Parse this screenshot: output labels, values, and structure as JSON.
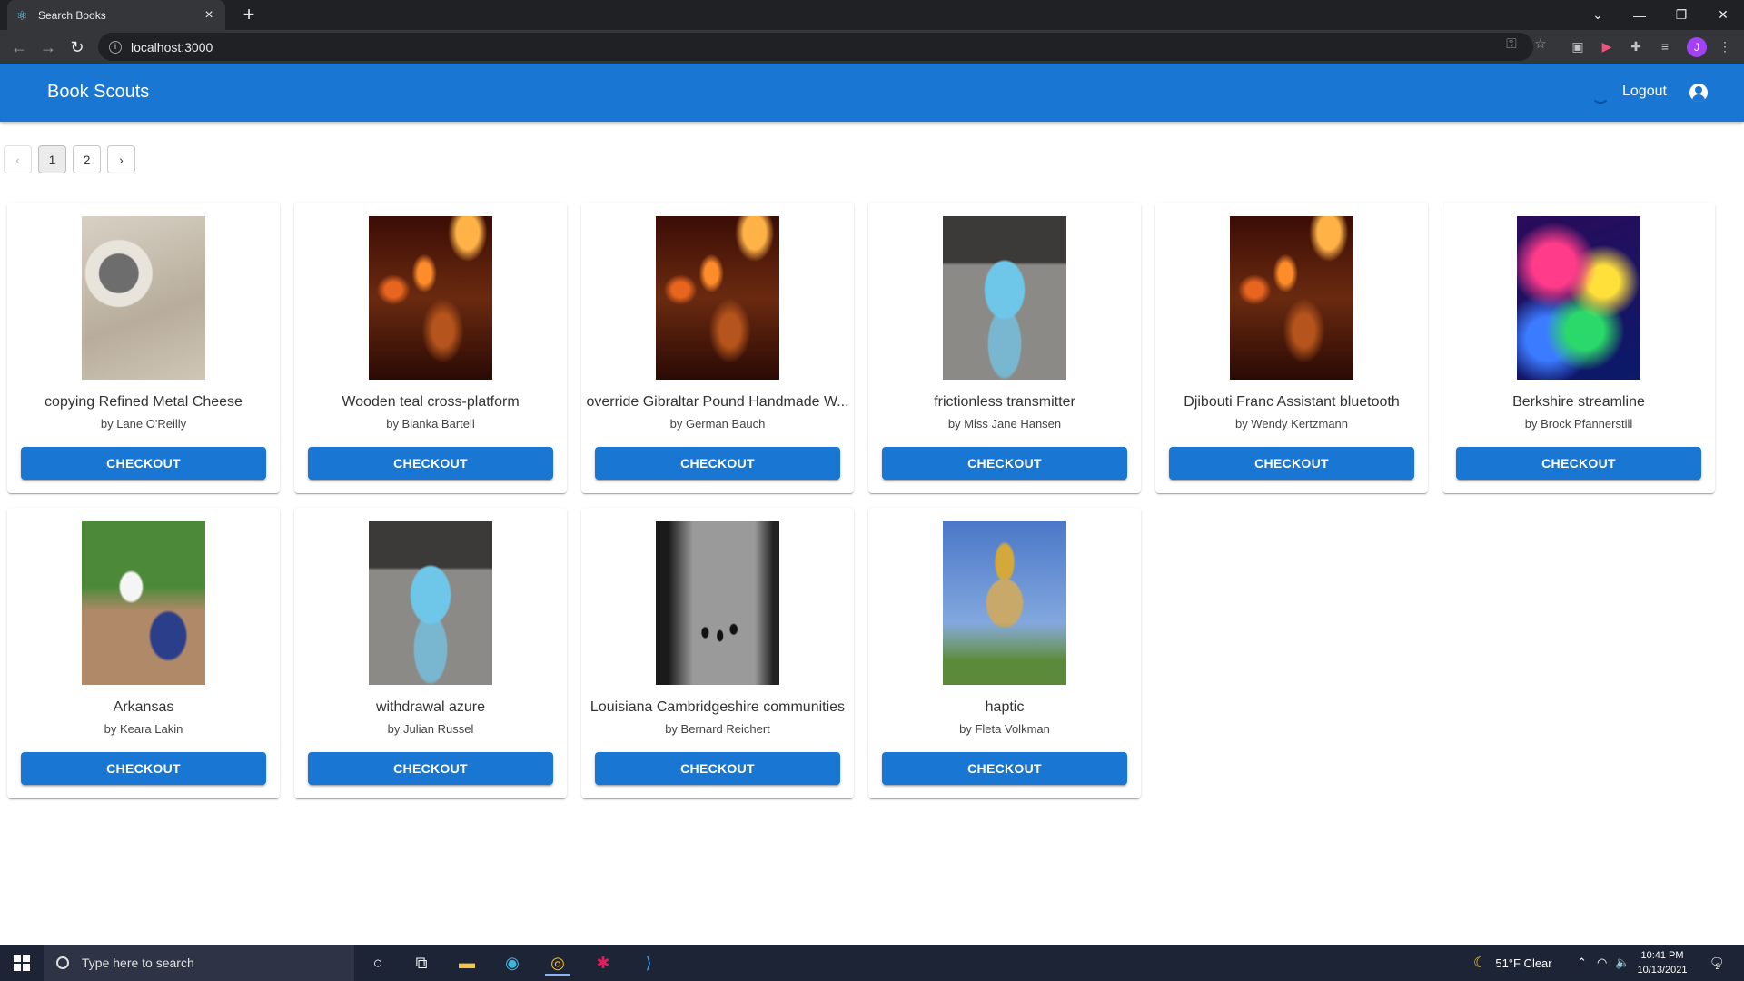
{
  "browser": {
    "tab_title": "Search Books",
    "url": "localhost:3000",
    "profile_initial": "J"
  },
  "app": {
    "brand": "Book Scouts",
    "logout_label": "Logout"
  },
  "pagination": {
    "prev": "‹",
    "pages": [
      "1",
      "2"
    ],
    "current": "1",
    "next": "›"
  },
  "checkout_label": "CHECKOUT",
  "books": [
    {
      "title": "copying Refined Metal Cheese",
      "author": "by Lane O'Reilly",
      "cover": "earphone"
    },
    {
      "title": "Wooden teal cross-platform",
      "author": "by Bianka Bartell",
      "cover": "restaurant"
    },
    {
      "title": "override Gibraltar Pound Handmade W...",
      "author": "by German Bauch",
      "cover": "restaurant"
    },
    {
      "title": "frictionless transmitter",
      "author": "by Miss Jane Hansen",
      "cover": "car"
    },
    {
      "title": "Djibouti Franc Assistant bluetooth",
      "author": "by Wendy Kertzmann",
      "cover": "restaurant"
    },
    {
      "title": "Berkshire streamline",
      "author": "by Brock Pfannerstill",
      "cover": "smoke"
    },
    {
      "title": "Arkansas",
      "author": "by Keara Lakin",
      "cover": "baseball"
    },
    {
      "title": "withdrawal azure",
      "author": "by Julian Russel",
      "cover": "car"
    },
    {
      "title": "Louisiana Cambridgeshire communities",
      "author": "by Bernard Reichert",
      "cover": "penguins"
    },
    {
      "title": "haptic",
      "author": "by Fleta Volkman",
      "cover": "dome"
    }
  ],
  "taskbar": {
    "search_placeholder": "Type here to search",
    "weather": "51°F  Clear",
    "time": "10:41 PM",
    "date": "10/13/2021",
    "notification_count": "2"
  },
  "colors": {
    "primary": "#1976d2",
    "browser_dark": "#202124",
    "taskbar": "#1d2436"
  }
}
